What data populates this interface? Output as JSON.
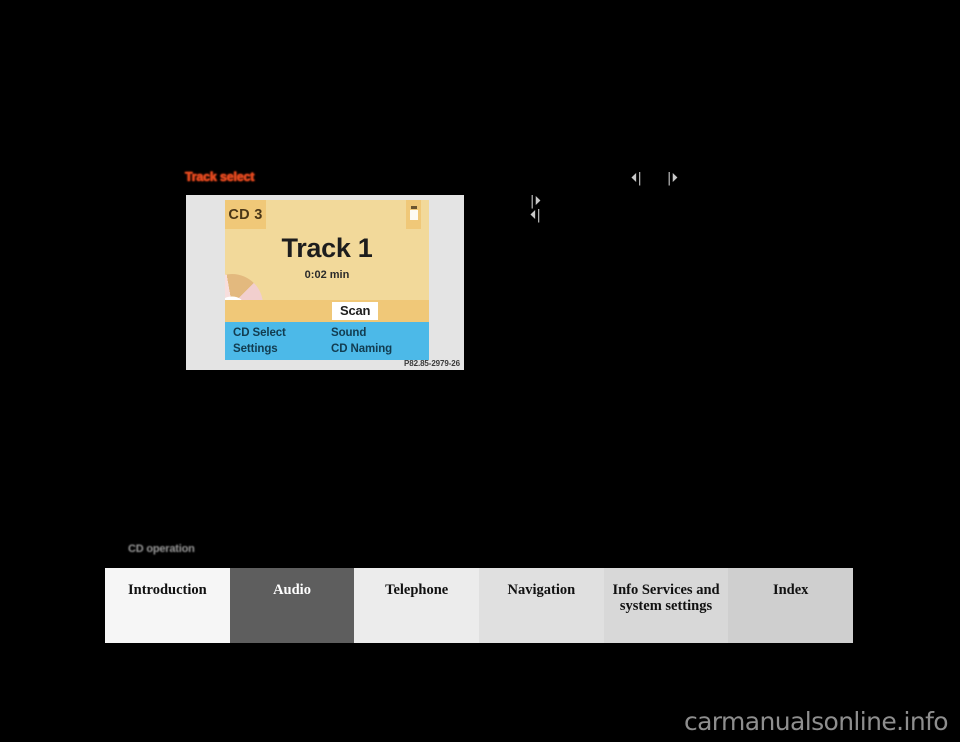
{
  "page": {
    "section_title": "Track select",
    "running_head": "CD operation",
    "watermark": "carmanualsonline.info"
  },
  "figure": {
    "caption": "P82.85-2979-26",
    "screen": {
      "cd_badge": "CD 3",
      "track_title": "Track 1",
      "track_time": "0:02 min",
      "scan_button": "Scan",
      "status_icon": "cd-loaded-icon",
      "disc_icon": "compact-disc-icon",
      "menu_items": [
        "CD Select",
        "Settings",
        "Sound",
        "CD Naming"
      ]
    }
  },
  "controls": {
    "glyphs": [
      {
        "name": "skip-back-icon",
        "char": "⏴|"
      },
      {
        "name": "skip-forward-icon",
        "char": "|⏵"
      },
      {
        "name": "skip-forward-icon-stacked",
        "char": "|⏵"
      },
      {
        "name": "skip-back-icon-stacked",
        "char": "⏴|"
      }
    ]
  },
  "footer": {
    "tabs": [
      {
        "label": "Introduction",
        "active": false
      },
      {
        "label": "Audio",
        "active": true
      },
      {
        "label": "Telephone",
        "active": false
      },
      {
        "label": "Navigation",
        "active": false
      },
      {
        "label": "Info Services and\nsystem settings",
        "active": false
      },
      {
        "label": "Index",
        "active": false
      }
    ]
  }
}
